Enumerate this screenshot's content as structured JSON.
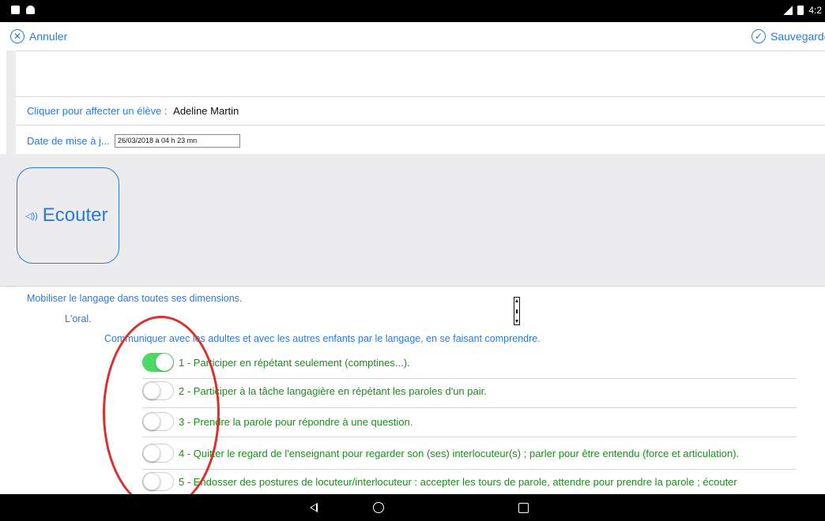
{
  "status_bar": {
    "time": "4:2"
  },
  "nav": {
    "cancel_label": "Annuler",
    "save_label": "Sauvegarde"
  },
  "form": {
    "student_label": "Cliquer pour affecter un élève :",
    "student_name": "Adeline Martin",
    "date_label": "Date de mise à j...",
    "date_value": "26/03/2018 à 04 h 23 mn"
  },
  "listen_button": {
    "label": "Ecouter",
    "icon": "speaker-icon"
  },
  "content": {
    "domain": "Mobiliser le langage dans toutes ses dimensions.",
    "subdomain": "L'oral.",
    "competence": "Communiquer avec les adultes et avec les autres enfants par le langage, en se faisant comprendre.",
    "items": [
      {
        "label": "1 - Participer en répétant seulement (comptines...).",
        "checked": true
      },
      {
        "label": "2 - Participer à la tâche langagière en répétant les paroles d'un pair.",
        "checked": false
      },
      {
        "label": "3 - Prendre la parole pour répondre à une question.",
        "checked": false
      },
      {
        "label": "4 - Quitter le regard de l'enseignant pour regarder son (ses) interlocuteur(s) ; parler pour être entendu (force et articulation).",
        "checked": false
      },
      {
        "label": "5 - Endosser des postures de locuteur/interlocuteur : accepter les tours de parole, attendre pour prendre la parole ; écouter",
        "checked": false
      }
    ]
  },
  "colors": {
    "accent": "#2a7ad8",
    "item_text": "#1f8a1f",
    "toggle_on": "#4cd964",
    "annotation": "#d8312e"
  }
}
